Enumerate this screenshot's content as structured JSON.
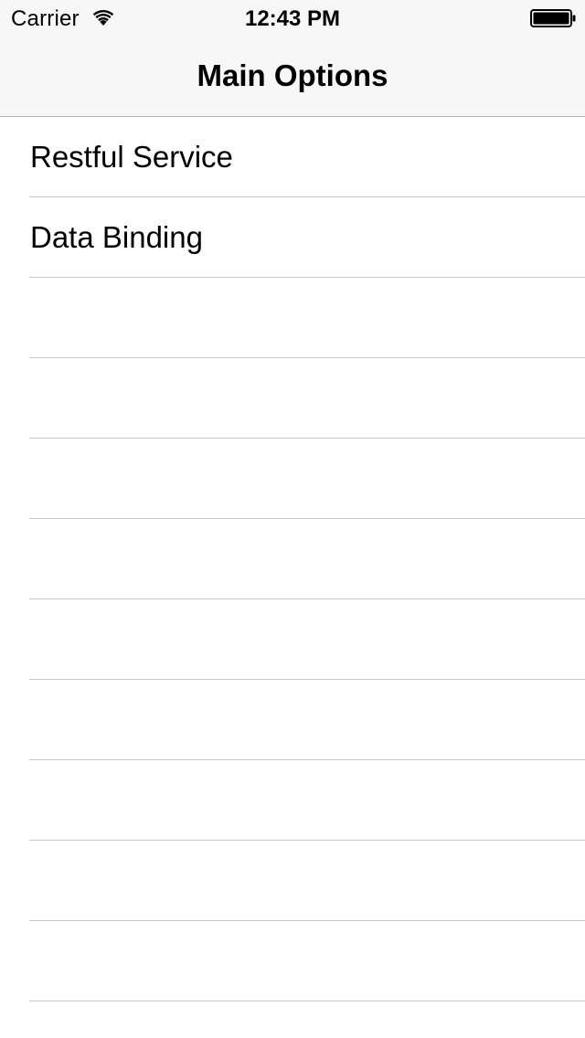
{
  "status_bar": {
    "carrier": "Carrier",
    "time": "12:43 PM"
  },
  "nav": {
    "title": "Main Options"
  },
  "table": {
    "rows": [
      {
        "label": "Restful Service"
      },
      {
        "label": "Data Binding"
      },
      {
        "label": ""
      },
      {
        "label": ""
      },
      {
        "label": ""
      },
      {
        "label": ""
      },
      {
        "label": ""
      },
      {
        "label": ""
      },
      {
        "label": ""
      },
      {
        "label": ""
      },
      {
        "label": ""
      },
      {
        "label": ""
      }
    ]
  },
  "icons": {
    "wifi": "wifi-icon",
    "battery": "battery-icon"
  }
}
